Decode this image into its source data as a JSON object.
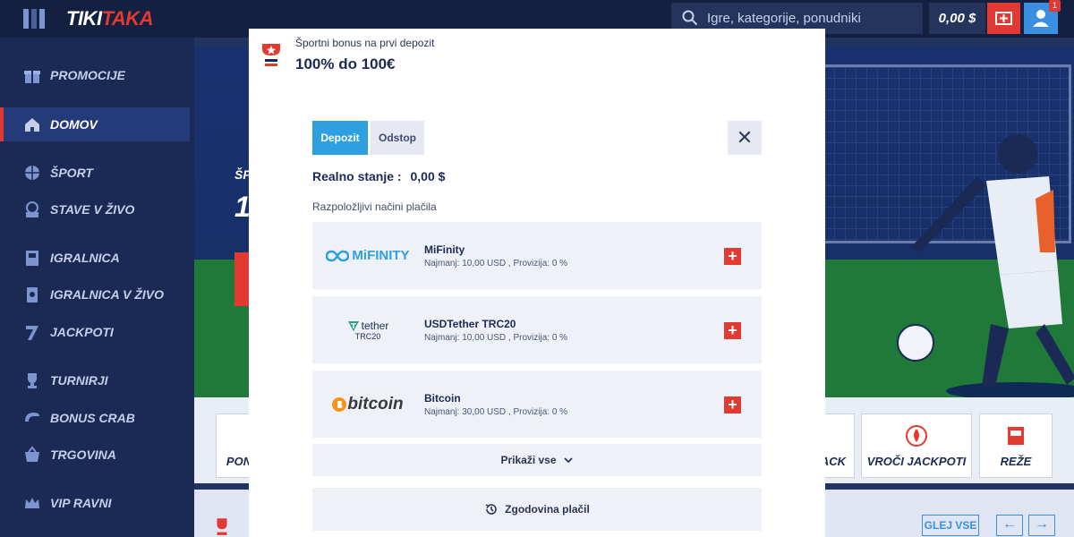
{
  "header": {
    "logo_part1": "TIKI",
    "logo_part2": "TAKA",
    "search_placeholder": "Igre, kategorije, ponudniki",
    "balance": "0,00 $",
    "notification_count": "1"
  },
  "sidebar": {
    "items": [
      {
        "label": "PROMOCIJE",
        "icon": "gift-icon"
      },
      {
        "label": "DOMOV",
        "icon": "home-icon",
        "active": true
      },
      {
        "label": "ŠPORT",
        "icon": "basketball-icon"
      },
      {
        "label": "STAVE V ŽIVO",
        "icon": "live-icon"
      },
      {
        "label": "IGRALNICA",
        "icon": "slot-machine-icon"
      },
      {
        "label": "IGRALNICA V ŽIVO",
        "icon": "cards-icon"
      },
      {
        "label": "JACKPOTI",
        "icon": "seven-icon"
      },
      {
        "label": "TURNIRJI",
        "icon": "trophy-icon"
      },
      {
        "label": "BONUS CRAB",
        "icon": "claw-icon"
      },
      {
        "label": "TRGOVINA",
        "icon": "basket-icon"
      },
      {
        "label": "VIP RAVNI",
        "icon": "crown-icon"
      }
    ]
  },
  "background": {
    "hero_text_1": "ŠP",
    "hero_text_2": "1",
    "shortcut_1": "PON",
    "shortcut_2": "ACK",
    "shortcut_3": "VROČI JACKPOTI",
    "shortcut_4": "REŽE",
    "see_all": "GLEJ VSE",
    "prev_arrow": "←",
    "next_arrow": "→"
  },
  "modal": {
    "bonus_subtitle": "Športni bonus na prvi depozit",
    "bonus_title": "100% do 100€",
    "tabs": [
      {
        "label": "Depozit",
        "active": true
      },
      {
        "label": "Odstop",
        "active": false
      }
    ],
    "close_symbol": "✕",
    "balance_label": "Realno stanje :",
    "balance_value": "0,00 $",
    "methods_label": "Razpoložljivi načini plačila",
    "methods": [
      {
        "name": "MiFinity",
        "meta": "Najmanj: 10,00 USD , Provizija: 0 %",
        "logo_text": "MiFINITY"
      },
      {
        "name": "USDTether TRC20",
        "meta": "Najmanj: 10,00 USD , Provizija: 0 %",
        "logo_text": "tether",
        "logo_sub": "TRC20"
      },
      {
        "name": "Bitcoin",
        "meta": "Najmanj: 30,00 USD , Provizija: 0 %",
        "logo_text": "bitcoin"
      }
    ],
    "add_symbol": "+",
    "show_all_label": "Prikaži vse",
    "history_label": "Zgodovina plačil"
  },
  "colors": {
    "accent_red": "#e23a32",
    "accent_blue": "#2ea0e0",
    "navy": "#1b2a55"
  }
}
